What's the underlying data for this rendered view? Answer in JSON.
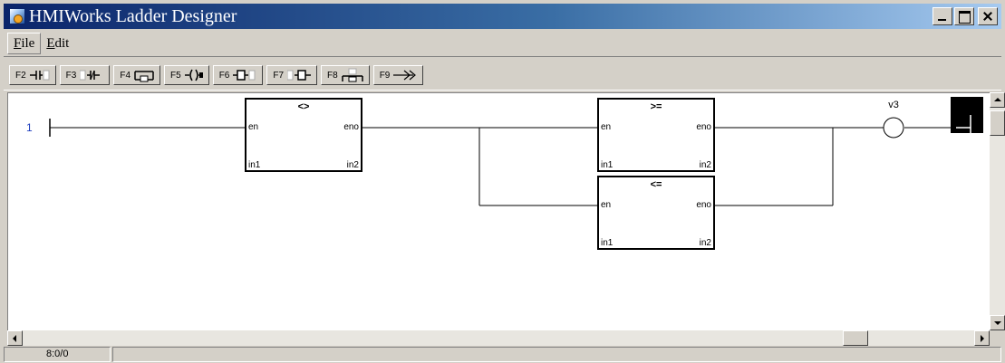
{
  "window": {
    "title": "HMIWorks Ladder Designer"
  },
  "menu": {
    "file": {
      "accel": "F",
      "rest": "ile"
    },
    "edit": {
      "accel": "E",
      "rest": "dit"
    }
  },
  "toolbar": {
    "buttons": [
      {
        "key": "F2",
        "icon": "contact-open-icon"
      },
      {
        "key": "F3",
        "icon": "contact-closed-icon"
      },
      {
        "key": "F4",
        "icon": "parallel-branch-icon"
      },
      {
        "key": "F5",
        "icon": "coil-icon"
      },
      {
        "key": "F6",
        "icon": "function-block-icon"
      },
      {
        "key": "F7",
        "icon": "insert-block-icon"
      },
      {
        "key": "F8",
        "icon": "branch-down-icon"
      },
      {
        "key": "F9",
        "icon": "jump-arrow-icon"
      }
    ]
  },
  "ladder": {
    "rung_number": "1",
    "blocks": [
      {
        "op": "<>",
        "pin_en": "en",
        "pin_eno": "eno",
        "pin_in1": "in1",
        "pin_in2": "in2"
      },
      {
        "op": ">=",
        "pin_en": "en",
        "pin_eno": "eno",
        "pin_in1": "in1",
        "pin_in2": "in2"
      },
      {
        "op": "<=",
        "pin_en": "en",
        "pin_eno": "eno",
        "pin_in1": "in1",
        "pin_in2": "in2"
      }
    ],
    "coil_label": "v3"
  },
  "status": {
    "position": "8:0/0"
  },
  "colors": {
    "rung_number": "#1f3fbf",
    "titlebar_start": "#0a246a",
    "titlebar_end": "#a6caf0"
  }
}
